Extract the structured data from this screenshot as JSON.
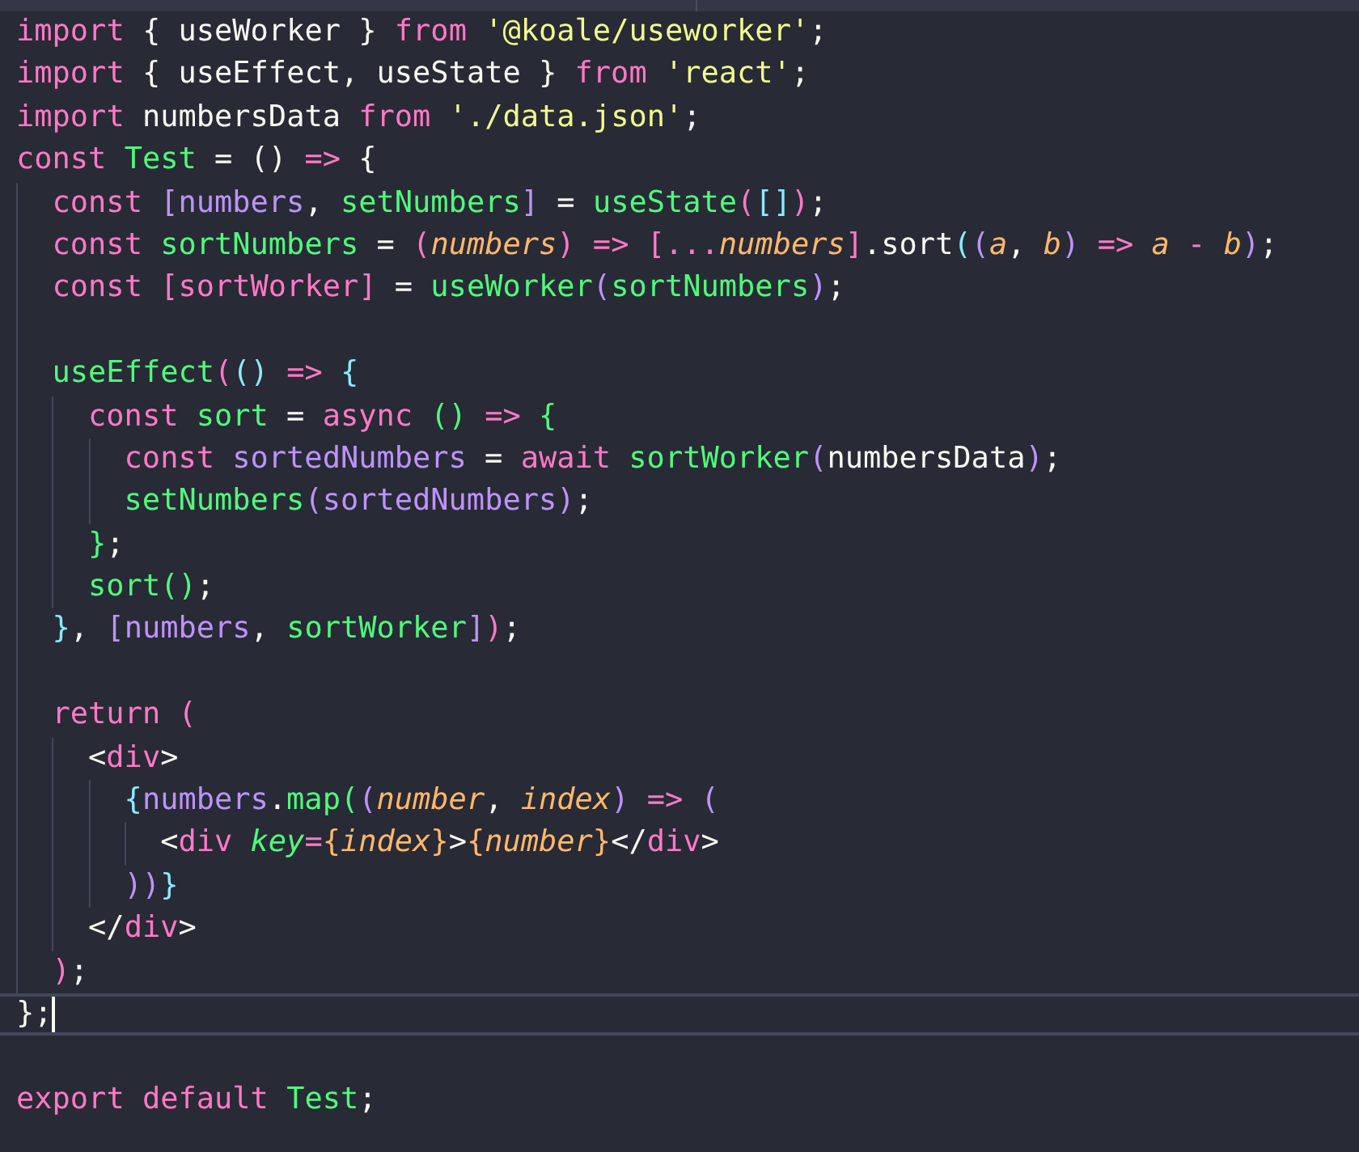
{
  "editor": {
    "lines": [
      {
        "tokens": [
          {
            "kind": "keyword",
            "text": "import"
          },
          {
            "kind": "plain",
            "text": " { useWorker } "
          },
          {
            "kind": "keyword",
            "text": "from "
          },
          {
            "kind": "string",
            "text": "'@koale/useworker'"
          },
          {
            "kind": "plain",
            "text": ";"
          }
        ]
      },
      {
        "tokens": [
          {
            "kind": "keyword",
            "text": "import"
          },
          {
            "kind": "plain",
            "text": " { useEffect, useState } "
          },
          {
            "kind": "keyword",
            "text": "from "
          },
          {
            "kind": "string",
            "text": "'react'"
          },
          {
            "kind": "plain",
            "text": ";"
          }
        ]
      },
      {
        "tokens": [
          {
            "kind": "keyword",
            "text": "import"
          },
          {
            "kind": "plain",
            "text": " numbersData "
          },
          {
            "kind": "keyword",
            "text": "from "
          },
          {
            "kind": "string",
            "text": "'./data.json'"
          },
          {
            "kind": "plain",
            "text": ";"
          }
        ]
      },
      {
        "tokens": [
          {
            "kind": "keyword",
            "text": "const "
          },
          {
            "kind": "function",
            "text": "Test"
          },
          {
            "kind": "plain",
            "text": " = () "
          },
          {
            "kind": "keyword",
            "text": "=> "
          },
          {
            "kind": "plain",
            "text": "{"
          }
        ],
        "children": [
          {
            "tokens": [
              {
                "kind": "keyword",
                "text": "const "
              },
              {
                "kind": "variable",
                "text": "[numbers"
              },
              {
                "kind": "plain",
                "text": ", "
              },
              {
                "kind": "function",
                "text": "setNumbers"
              },
              {
                "kind": "variable",
                "text": "]"
              },
              {
                "kind": "plain",
                "text": " = "
              },
              {
                "kind": "function",
                "text": "useState"
              },
              {
                "kind": "keyword",
                "text": "("
              },
              {
                "kind": "bracket",
                "text": "[]"
              },
              {
                "kind": "keyword",
                "text": ")"
              },
              {
                "kind": "plain",
                "text": ";"
              }
            ]
          },
          {
            "tokens": [
              {
                "kind": "keyword",
                "text": "const "
              },
              {
                "kind": "function",
                "text": "sortNumbers"
              },
              {
                "kind": "plain",
                "text": " = "
              },
              {
                "kind": "keyword",
                "text": "("
              },
              {
                "kind": "parameter",
                "text": "numbers"
              },
              {
                "kind": "keyword",
                "text": ") => [..."
              },
              {
                "kind": "parameter",
                "text": "numbers"
              },
              {
                "kind": "keyword",
                "text": "]"
              },
              {
                "kind": "plain",
                "text": ".sort"
              },
              {
                "kind": "bracket",
                "text": "("
              },
              {
                "kind": "variable",
                "text": "("
              },
              {
                "kind": "parameter",
                "text": "a"
              },
              {
                "kind": "plain",
                "text": ", "
              },
              {
                "kind": "parameter",
                "text": "b"
              },
              {
                "kind": "variable",
                "text": ")"
              },
              {
                "kind": "keyword",
                "text": " => "
              },
              {
                "kind": "parameter",
                "text": "a"
              },
              {
                "kind": "keyword",
                "text": " - "
              },
              {
                "kind": "parameter",
                "text": "b"
              },
              {
                "kind": "variable",
                "text": ")"
              },
              {
                "kind": "plain",
                "text": ";"
              }
            ]
          },
          {
            "tokens": [
              {
                "kind": "keyword",
                "text": "const [sortWorker]"
              },
              {
                "kind": "plain",
                "text": " = "
              },
              {
                "kind": "function",
                "text": "useWorker"
              },
              {
                "kind": "variable",
                "text": "("
              },
              {
                "kind": "function",
                "text": "sortNumbers"
              },
              {
                "kind": "variable",
                "text": ")"
              },
              {
                "kind": "plain",
                "text": ";"
              }
            ],
            "space_after": true
          },
          {
            "tokens": [
              {
                "kind": "function",
                "text": "useEffect"
              },
              {
                "kind": "keyword",
                "text": "("
              },
              {
                "kind": "bracket",
                "text": "() "
              },
              {
                "kind": "keyword",
                "text": "=> "
              },
              {
                "kind": "bracket",
                "text": "{"
              }
            ],
            "children": [
              {
                "tokens": [
                  {
                    "kind": "keyword",
                    "text": "const "
                  },
                  {
                    "kind": "function",
                    "text": "sort"
                  },
                  {
                    "kind": "plain",
                    "text": " = "
                  },
                  {
                    "kind": "keyword",
                    "text": "async "
                  },
                  {
                    "kind": "function",
                    "text": "() "
                  },
                  {
                    "kind": "keyword",
                    "text": "=> "
                  },
                  {
                    "kind": "function",
                    "text": "{"
                  }
                ],
                "children": [
                  {
                    "tokens": [
                      {
                        "kind": "keyword",
                        "text": "const "
                      },
                      {
                        "kind": "variable",
                        "text": "sortedNumbers"
                      },
                      {
                        "kind": "plain",
                        "text": " = "
                      },
                      {
                        "kind": "keyword",
                        "text": "await "
                      },
                      {
                        "kind": "function",
                        "text": "sortWorker"
                      },
                      {
                        "kind": "variable",
                        "text": "("
                      },
                      {
                        "kind": "plain",
                        "text": "numbersData"
                      },
                      {
                        "kind": "variable",
                        "text": ")"
                      },
                      {
                        "kind": "plain",
                        "text": ";"
                      }
                    ]
                  },
                  {
                    "tokens": [
                      {
                        "kind": "function",
                        "text": "setNumbers"
                      },
                      {
                        "kind": "variable",
                        "text": "(sortedNumbers)"
                      },
                      {
                        "kind": "plain",
                        "text": ";"
                      }
                    ]
                  }
                ]
              },
              {
                "tokens": [
                  {
                    "kind": "function",
                    "text": "}"
                  },
                  {
                    "kind": "plain",
                    "text": ";"
                  }
                ]
              },
              {
                "tokens": [
                  {
                    "kind": "function",
                    "text": "sort()"
                  },
                  {
                    "kind": "plain",
                    "text": ";"
                  }
                ]
              }
            ]
          },
          {
            "tokens": [
              {
                "kind": "bracket",
                "text": "}"
              },
              {
                "kind": "plain",
                "text": ", "
              },
              {
                "kind": "variable",
                "text": "[numbers"
              },
              {
                "kind": "plain",
                "text": ", "
              },
              {
                "kind": "function",
                "text": "sortWorker"
              },
              {
                "kind": "variable",
                "text": "]"
              },
              {
                "kind": "keyword",
                "text": ")"
              },
              {
                "kind": "plain",
                "text": ";"
              }
            ],
            "space_after": true
          },
          {
            "tokens": [
              {
                "kind": "keyword",
                "text": "return ("
              }
            ],
            "children": [
              {
                "tokens": [
                  {
                    "kind": "plain",
                    "text": "<"
                  },
                  {
                    "kind": "keyword",
                    "text": "div"
                  },
                  {
                    "kind": "plain",
                    "text": ">"
                  }
                ],
                "children": [
                  {
                    "tokens": [
                      {
                        "kind": "bracket",
                        "text": "{"
                      },
                      {
                        "kind": "variable",
                        "text": "numbers"
                      },
                      {
                        "kind": "plain",
                        "text": "."
                      },
                      {
                        "kind": "function",
                        "text": "map("
                      },
                      {
                        "kind": "variable",
                        "text": "("
                      },
                      {
                        "kind": "parameter",
                        "text": "number"
                      },
                      {
                        "kind": "plain",
                        "text": ", "
                      },
                      {
                        "kind": "parameter",
                        "text": "index"
                      },
                      {
                        "kind": "variable",
                        "text": ")"
                      },
                      {
                        "kind": "keyword",
                        "text": " => "
                      },
                      {
                        "kind": "variable",
                        "text": "("
                      }
                    ],
                    "children": [
                      {
                        "tokens": [
                          {
                            "kind": "plain",
                            "text": "<"
                          },
                          {
                            "kind": "keyword",
                            "text": "div "
                          },
                          {
                            "kind": "attribute",
                            "text": "key"
                          },
                          {
                            "kind": "keyword",
                            "text": "="
                          },
                          {
                            "kind": "brace",
                            "text": "{"
                          },
                          {
                            "kind": "parameter",
                            "text": "index"
                          },
                          {
                            "kind": "brace",
                            "text": "}"
                          },
                          {
                            "kind": "plain",
                            "text": ">"
                          },
                          {
                            "kind": "brace",
                            "text": "{"
                          },
                          {
                            "kind": "parameter",
                            "text": "number"
                          },
                          {
                            "kind": "brace",
                            "text": "}"
                          },
                          {
                            "kind": "plain",
                            "text": "</"
                          },
                          {
                            "kind": "keyword",
                            "text": "div"
                          },
                          {
                            "kind": "plain",
                            "text": ">"
                          }
                        ]
                      }
                    ]
                  },
                  {
                    "tokens": [
                      {
                        "kind": "variable",
                        "text": "))"
                      },
                      {
                        "kind": "bracket",
                        "text": "}"
                      }
                    ]
                  }
                ]
              },
              {
                "tokens": [
                  {
                    "kind": "plain",
                    "text": "</"
                  },
                  {
                    "kind": "keyword",
                    "text": "div"
                  },
                  {
                    "kind": "plain",
                    "text": ">"
                  }
                ]
              }
            ]
          },
          {
            "tokens": [
              {
                "kind": "keyword",
                "text": ")"
              },
              {
                "kind": "plain",
                "text": ";"
              }
            ]
          }
        ]
      },
      {
        "current": true,
        "space_after": true,
        "tokens": [
          {
            "kind": "plain",
            "text": "};"
          }
        ]
      },
      {
        "tokens": [
          {
            "kind": "keyword",
            "text": "export default "
          },
          {
            "kind": "function",
            "text": "Test"
          },
          {
            "kind": "plain",
            "text": ";"
          }
        ]
      }
    ]
  }
}
